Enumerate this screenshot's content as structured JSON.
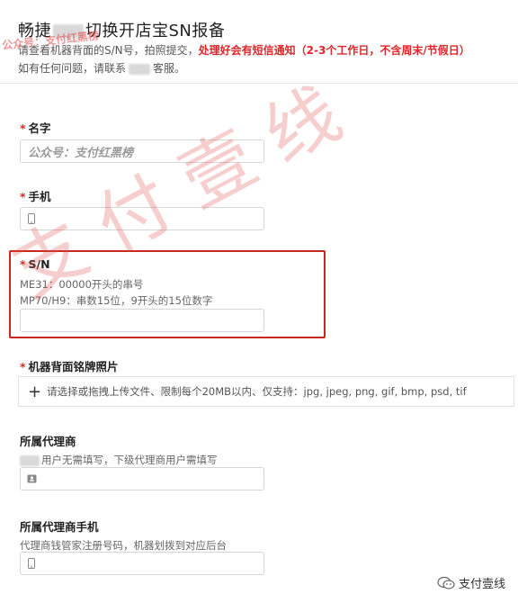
{
  "header": {
    "title_prefix": "畅捷",
    "title_suffix": "切换开店宝SN报备"
  },
  "intro": {
    "line1_normal": "请查看机器背面的S/N号，拍照提交，",
    "line1_warn": "处理好会有短信通知（2-3个工作日，不含周末/节假日）",
    "line2_prefix": "如有任何问题，请联系",
    "line2_suffix": "客服。"
  },
  "fields": {
    "name": {
      "required": "*",
      "label": "名字",
      "value": "公众号：支付红黑榜"
    },
    "phone": {
      "required": "*",
      "label": "手机",
      "value": ""
    },
    "sn": {
      "required": "*",
      "label": "S/N",
      "help1": "ME31：00000开头的串号",
      "help2": "MP70/H9：串数15位，9开头的15位数字",
      "value": ""
    },
    "photo": {
      "required": "*",
      "label": "机器背面铭牌照片",
      "upload_icon": "plus-icon",
      "upload_text": "请选择或拖拽上传文件、限制每个20MB以内、仅支持：jpg, jpeg, png, gif, bmp, psd, tif"
    },
    "agent": {
      "label": "所属代理商",
      "help": "用户无需填写，下级代理商用户需填写",
      "icon": "id-card-icon",
      "value": ""
    },
    "agent_phone": {
      "label": "所属代理商手机",
      "help": "代理商钱管家注册号码，机器划拨到对应后台",
      "icon": "phone-icon",
      "value": ""
    }
  },
  "watermarks": {
    "diagonal": "支付壹线",
    "top_corner": "公众号：支付红黑榜"
  },
  "footer": {
    "icon": "wechat-icon",
    "text": "支付壹线"
  },
  "colors": {
    "warn": "#e0262c",
    "highlight_box": "#c8291c",
    "watermark": "#e25050"
  }
}
